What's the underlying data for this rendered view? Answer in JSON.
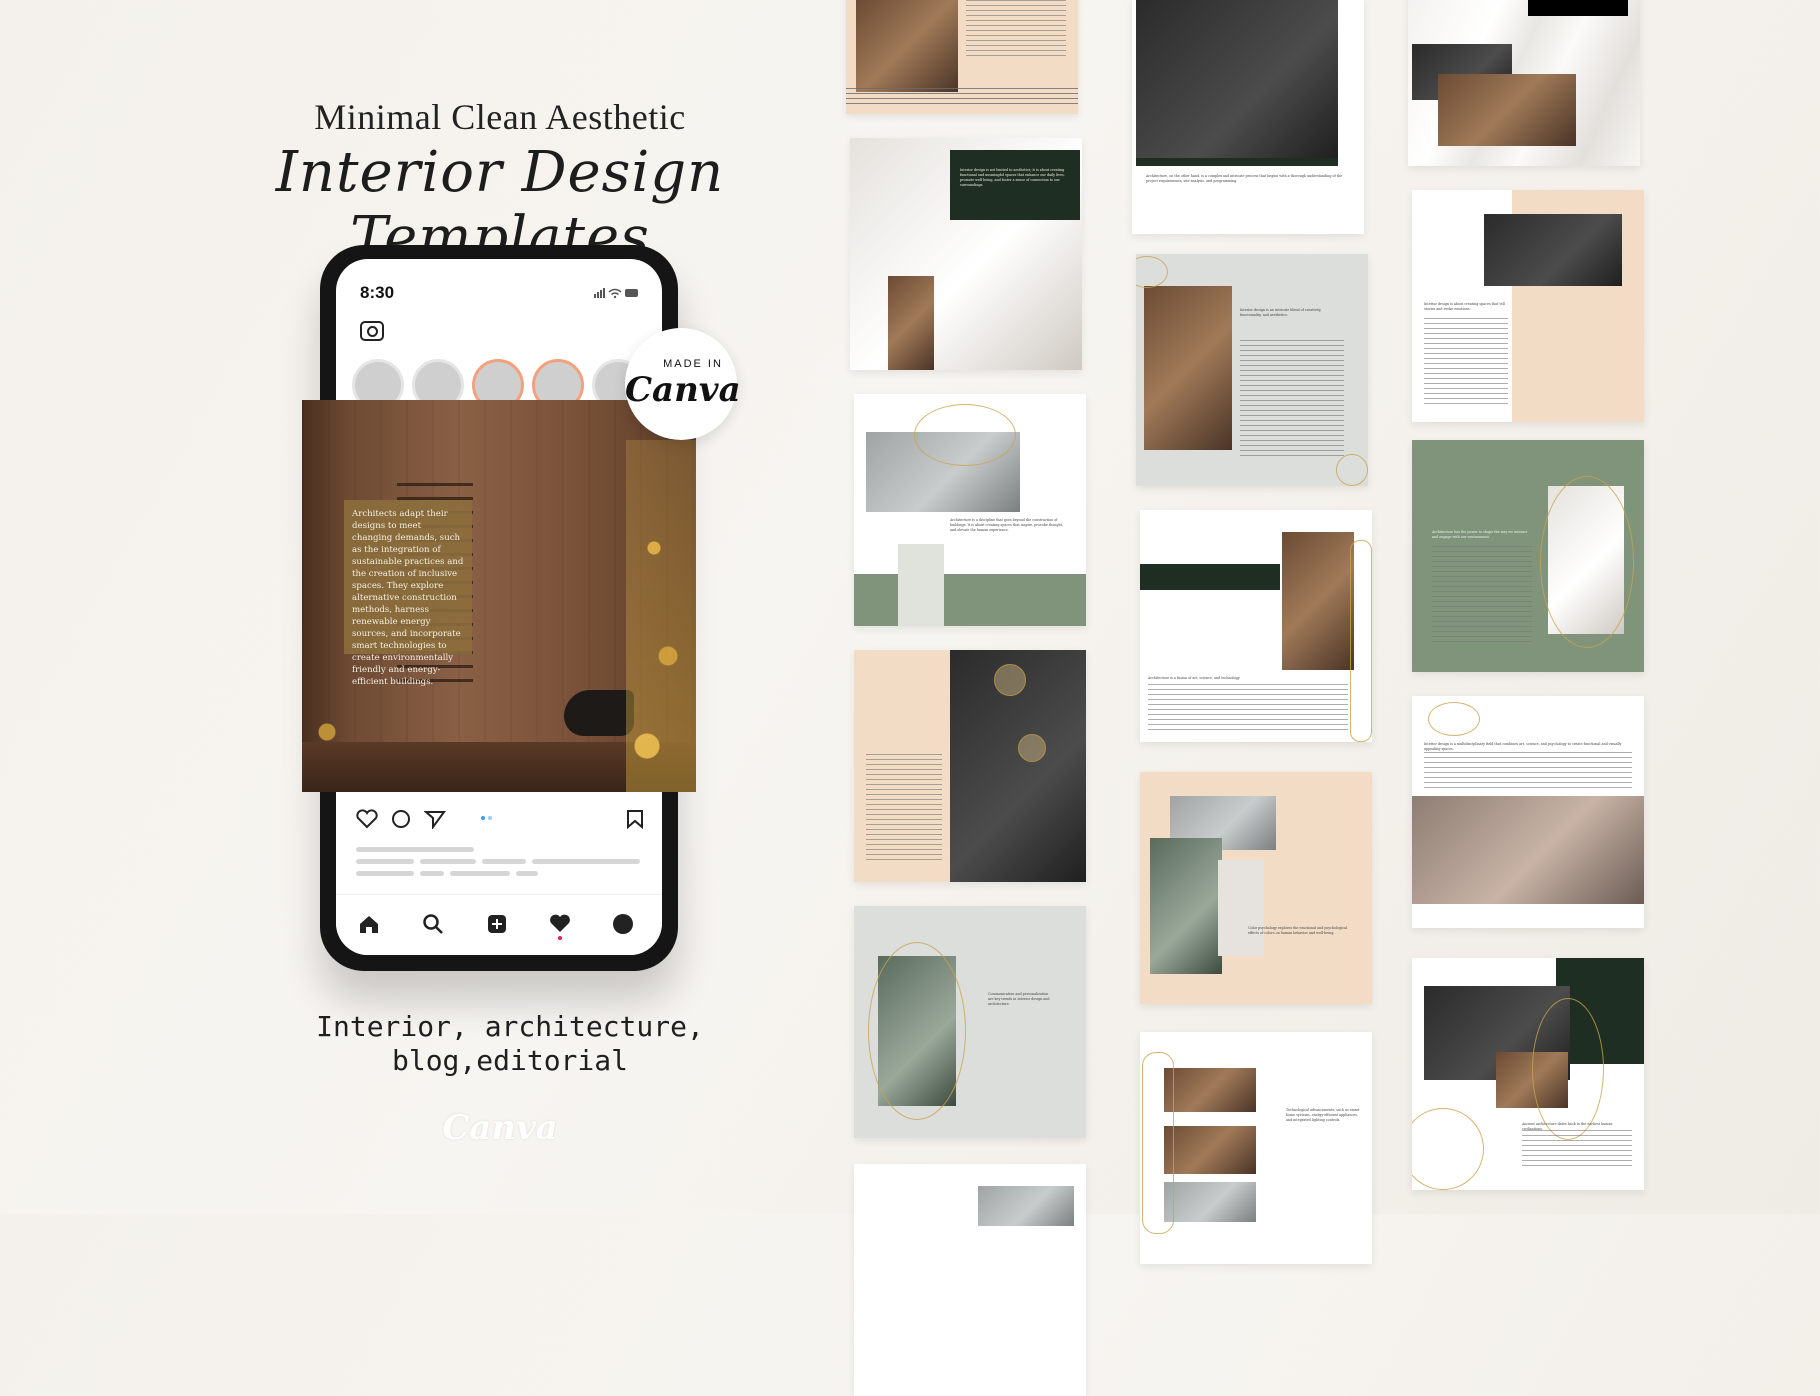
{
  "hero": {
    "subtitle": "Minimal Clean Aesthetic",
    "title": "Interior Design Templates",
    "caption_line1": "Interior, architecture,",
    "caption_line2": "blog,editorial",
    "footer_brand": "Canva"
  },
  "badge": {
    "made_in": "MADE IN",
    "brand": "Canva"
  },
  "phone": {
    "time": "8:30",
    "status_icons": "signal wifi battery",
    "post_quote": "Architects adapt their designs to meet changing demands, such as the integration of sustainable practices and the creation of inclusive spaces. They explore alternative construction methods, harness renewable energy sources, and incorporate smart technologies to create environmentally friendly and energy-efficient buildings.",
    "nav_icons": [
      "home-icon",
      "search-icon",
      "add-icon",
      "heart-icon",
      "profile-icon"
    ],
    "action_icons": [
      "heart-icon",
      "comment-icon",
      "share-icon",
      "bookmark-icon"
    ]
  },
  "templates": {
    "t_col1_2": "Interior design is not limited to aesthetics; it is about creating functional and meaningful spaces that enhance our daily lives, promote well-being, and foster a sense of connection to our surroundings.",
    "t_col1_3": "Architecture is a discipline that goes beyond the construction of buildings. It is about creating spaces that inspire, provoke thought, and elevate the human experience.",
    "t_col1_5": "Communication and personalization are key trends in interior design and architecture.",
    "t_col2_1": "Architecture, on the other hand, is a complex and intricate process that begins with a thorough understanding of the project requirements, site analysis, and programming.",
    "t_col2_2": "Interior design is an intricate blend of creativity, functionality, and aesthetics.",
    "t_col2_3": "Architecture is a fusion of art, science, and technology.",
    "t_col2_4": "Color psychology explores the emotional and psychological effects of colors on human behavior and well-being.",
    "t_col2_5": "Technological advancements, such as smart home systems, energy-efficient appliances, and integrated lighting controls.",
    "t_col3_2": "Interior design is about creating spaces that tell stories and evoke emotions.",
    "t_col3_3": "Architecture has the power to shape the way we interact and engage with our environment.",
    "t_col3_4": "Interior design is a multidisciplinary field that combines art, science, and psychology to create functional and visually appealing spaces.",
    "t_col3_5": "Ancient architecture dates back to the earliest human civilizations."
  },
  "colors": {
    "background": "#f4f1ec",
    "sage_green": "#7f947a",
    "forest_green": "#1f2e22",
    "peach": "#f3dcc6",
    "light_grey": "#dcdedb",
    "gold_accent": "#c9a24e"
  }
}
